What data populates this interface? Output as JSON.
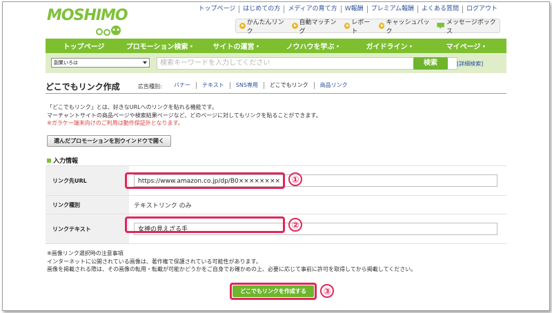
{
  "logo": {
    "text": "MOSHIMO"
  },
  "top_links": [
    "トップページ",
    "はじめての方",
    "メディアの育て方",
    "W報酬",
    "プレミアム報酬",
    "よくある質問",
    "ログアウト"
  ],
  "quick_links": [
    {
      "label": "かんたんリンク",
      "icon": "play-circle-icon"
    },
    {
      "label": "自動マッチング",
      "icon": "play-circle-icon"
    },
    {
      "label": "レポート",
      "icon": "play-circle-icon"
    },
    {
      "label": "キャッシュバック",
      "icon": "play-circle-icon"
    },
    {
      "label": "メッセージボックス",
      "icon": "speech-bubble-icon"
    }
  ],
  "nav": [
    "トップページ",
    "プロモーション検索・",
    "サイトの運営・",
    "ノウハウを学ぶ・",
    "ガイドライン・",
    "マイページ・"
  ],
  "search": {
    "site_select": "副業いろは",
    "placeholder": "検索キーワードを入力してください",
    "button": "検索",
    "advanced": "[詳細検索]"
  },
  "page": {
    "title": "どこでもリンク作成",
    "adtype_label": "広告種別:",
    "adtypes": [
      "バナー",
      "テキスト",
      "SNS専用",
      "どこでもリンク",
      "商品リンク"
    ],
    "description": [
      "「どこでもリンク」とは、好きなURLへのリンクを貼れる機能です。",
      "マーチャントサイトの商品ページや検索結果ページなど、どのページに対してもリンクを貼ることができます。"
    ],
    "warning": "※ガラケー端末向けのご利用は動作保証外となります。",
    "open_button": "選んだプロモーションを別ウインドウで開く",
    "section_title": "入力情報"
  },
  "form": {
    "url_label": "リンク先URL",
    "url_value": "https://www.amazon.co.jp/dp/B0××××××××",
    "type_label": "リンク種別",
    "type_value": "テキストリンク のみ",
    "text_label": "リンクテキスト",
    "text_value": "女神の見えざる手"
  },
  "notes": [
    "※画像リンク選択時の注意事項",
    "インターネットに公開されている画像は、著作権で保護されている可能性があります。",
    "画像を掲載される際は、その画像の転用・転載が可能かどうかをご自身でお確かめの上、必要に応じて事前に許可を取得してから掲載してください。"
  ],
  "create_button": "どこでもリンクを作成する",
  "annotations": [
    "①",
    "②",
    "③"
  ],
  "colors": {
    "brand_green": "#7ebf2f",
    "highlight": "#e0265a",
    "link_blue": "#2a4f9c",
    "warning_red": "#e23b3b"
  }
}
